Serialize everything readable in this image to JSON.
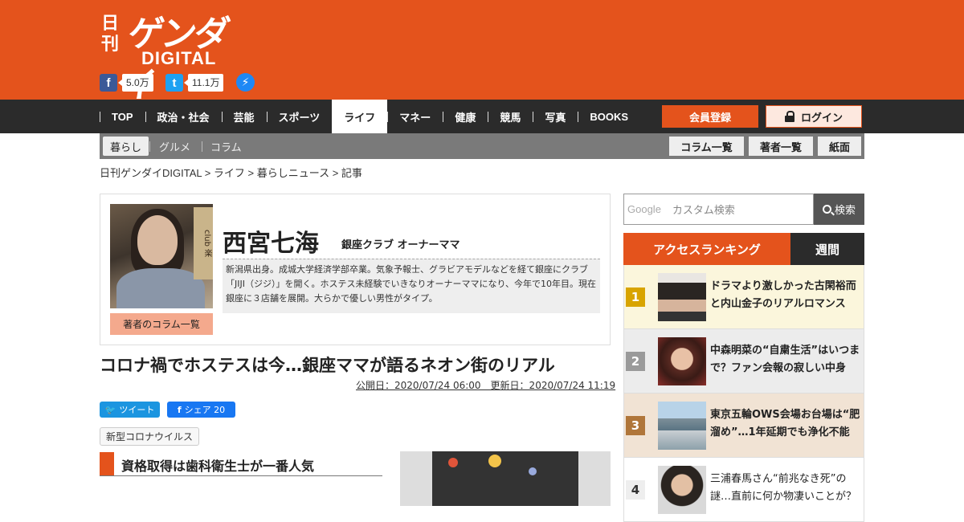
{
  "header": {
    "logo_nikkan": "日刊",
    "logo_main": "ゲンダイ",
    "logo_digital": "DIGITAL",
    "social": [
      {
        "icon": "facebook-icon",
        "glyph": "f",
        "count": "5.0万",
        "color": "#3b5998"
      },
      {
        "icon": "twitter-icon",
        "glyph": "t",
        "count": "11.1万",
        "color": "#1da1f2"
      }
    ],
    "messenger_glyph": "⚡"
  },
  "nav": {
    "items": [
      "TOP",
      "政治・社会",
      "芸能",
      "スポーツ",
      "ライフ",
      "マネー",
      "健康",
      "競馬",
      "写真",
      "BOOKS"
    ],
    "active": "ライフ",
    "register": "会員登録",
    "login": "ログイン"
  },
  "subnav": {
    "items": [
      "暮らし",
      "グルメ",
      "コラム"
    ],
    "right": [
      "コラム一覧",
      "著者一覧",
      "紙面"
    ]
  },
  "breadcrumb": "日刊ゲンダイDIGITAL > ライフ > 暮らしニュース > 記事",
  "author": {
    "name": "西宮七海",
    "title": "銀座クラブ オーナーママ",
    "bio": "新潟県出身。成城大学経済学部卒業。気象予報士、グラビアモデルなどを経て銀座にクラブ「JIJI（ジジ）」を開く。ホステス未経験でいきなりオーナーママになり、今年で10年目。現在銀座に３店舗を展開。大らかで優しい男性がタイプ。",
    "columns_button": "著者のコラム一覧",
    "photo_sign": "club 楽"
  },
  "article": {
    "title": "コロナ禍でホステスは今…銀座ママが語るネオン街のリアル",
    "dates": "公開日：2020/07/24 06:00　更新日：2020/07/24 11:19",
    "tweet_label": "ツイート",
    "share_label": "シェア 20",
    "tag": "新型コロナウイルス",
    "subheading": "資格取得は歯科衛生士が一番人気"
  },
  "sidebar": {
    "search_brand": "Google",
    "search_placeholder": "カスタム検索",
    "search_button": "検索",
    "ranking_title": "アクセスランキング",
    "ranking_tab": "週間",
    "ranking": [
      {
        "num": "1",
        "title": "ドラマより激しかった古閑裕而と内山金子のリアルロマンス",
        "num_color": "#d8a400",
        "bg": "#fbf6dc"
      },
      {
        "num": "2",
        "title": "中森明菜の“自粛生活”はいつまで？ファン会報の寂しい中身",
        "num_color": "#9a9a9a",
        "bg": "#ececec"
      },
      {
        "num": "3",
        "title": "東京五輪OWS会場お台場は“肥溜め”…1年延期でも浄化不能",
        "num_color": "#b0763a",
        "bg": "#f1e3d4"
      },
      {
        "num": "4",
        "title": "三浦春馬さん“前兆なき死”の謎…直前に何か物凄いことが？",
        "num_color": "#eeeeee",
        "bg": "#ffffff"
      }
    ]
  }
}
